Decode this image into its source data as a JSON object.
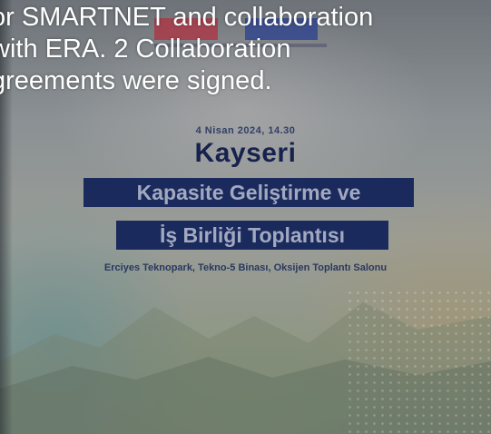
{
  "caption": {
    "text": "or SMARTNET and collaboration\nwith ERA. 2 Collaboration\ngreements were signed."
  },
  "poster": {
    "date_time": "4 Nisan 2024, 14.30",
    "city": "Kayseri",
    "title_line_1": "Kapasite Geliştirme ve",
    "title_line_2": "İş Birliği Toplantısı",
    "venue": "Erciyes Teknopark, Tekno-5 Binası, Oksijen Toplantı Salonu"
  },
  "colors": {
    "navy": "#1b2a5c",
    "caption_text": "#ffffff"
  }
}
